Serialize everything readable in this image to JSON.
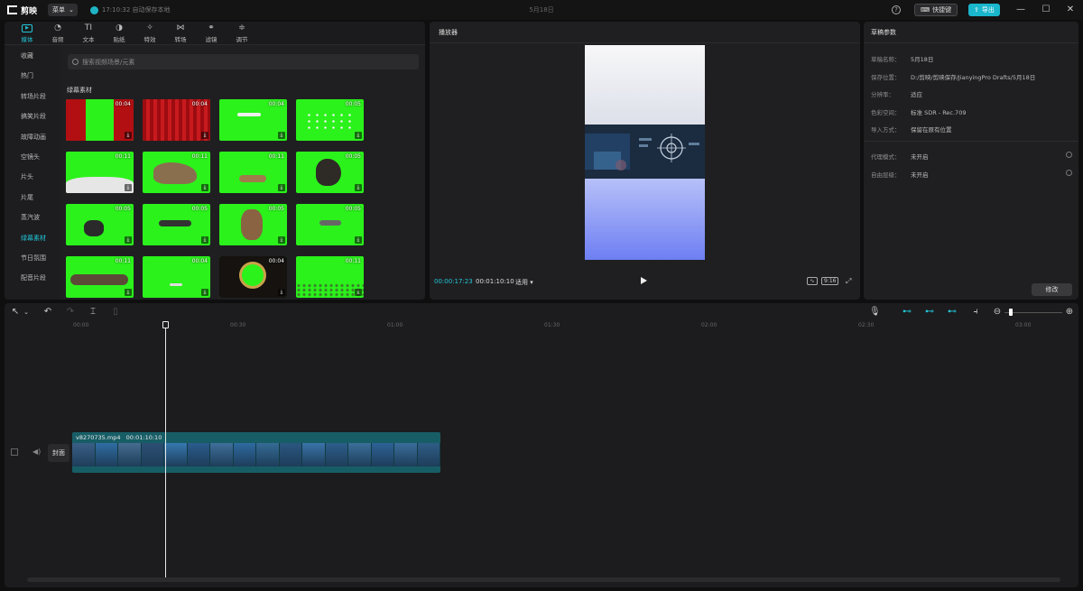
{
  "titlebar": {
    "app_name": "剪映",
    "menu_label": "菜单",
    "save_status": "17:10:32 自动保存本地",
    "doc_title": "5月18日",
    "shortcut_label": "快捷键",
    "export_label": "导出"
  },
  "media_tabs": [
    {
      "label": "媒体",
      "icon": "media-icon",
      "active": true
    },
    {
      "label": "音频",
      "icon": "audio-icon"
    },
    {
      "label": "文本",
      "icon": "text-icon"
    },
    {
      "label": "贴纸",
      "icon": "sticker-icon"
    },
    {
      "label": "特效",
      "icon": "effects-icon"
    },
    {
      "label": "转场",
      "icon": "transition-icon"
    },
    {
      "label": "滤镜",
      "icon": "filter-icon"
    },
    {
      "label": "调节",
      "icon": "adjust-icon"
    }
  ],
  "sidebar": {
    "items": [
      "收藏",
      "热门",
      "转场片段",
      "搞笑片段",
      "故障动画",
      "空镜头",
      "片头",
      "片尾",
      "蒸汽波",
      "绿幕素材",
      "节日氛围",
      "配音片段"
    ],
    "active_index": 9
  },
  "search": {
    "placeholder": "搜索视频场景/元素"
  },
  "section_title": "绿幕素材",
  "thumbs": [
    {
      "dur": "00:04",
      "kind": "curtain"
    },
    {
      "dur": "00:04",
      "kind": "curtain2"
    },
    {
      "dur": "00:04",
      "kind": "plane"
    },
    {
      "dur": "00:05",
      "kind": "birds"
    },
    {
      "dur": "00:11",
      "kind": "smoke"
    },
    {
      "dur": "00:11",
      "kind": "dino"
    },
    {
      "dur": "00:11",
      "kind": "dog"
    },
    {
      "dur": "00:05",
      "kind": "meteor"
    },
    {
      "dur": "00:05",
      "kind": "rock"
    },
    {
      "dur": "00:05",
      "kind": "whale"
    },
    {
      "dur": "00:05",
      "kind": "dino2"
    },
    {
      "dur": "00:05",
      "kind": "shark"
    },
    {
      "dur": "00:11",
      "kind": "log"
    },
    {
      "dur": "00:04",
      "kind": "plane2"
    },
    {
      "dur": "00:04",
      "kind": "badge"
    },
    {
      "dur": "00:11",
      "kind": "grass"
    }
  ],
  "player": {
    "title": "播放器",
    "current_time": "00:00:17:23",
    "total_time": "00:01:10:10",
    "quality": "适用",
    "ratio": "9:16"
  },
  "props": {
    "title": "草稿参数",
    "rows": [
      {
        "k": "草稿名称：",
        "v": "5月18日"
      },
      {
        "k": "保存位置：",
        "v": "D:/剪映/剪映保存/JianyingPro Drafts/5月18日"
      },
      {
        "k": "分辨率：",
        "v": "适应"
      },
      {
        "k": "色彩空间：",
        "v": "标准 SDR - Rec.709"
      },
      {
        "k": "导入方式：",
        "v": "保留在原有位置"
      }
    ],
    "rows2": [
      {
        "k": "代理模式：",
        "v": "未开启"
      },
      {
        "k": "自由层级：",
        "v": "未开启"
      }
    ],
    "modify_label": "修改"
  },
  "timeline": {
    "ticks": [
      "00:00",
      "00:30",
      "01:00",
      "01:30",
      "02:00",
      "02:30",
      "03:00"
    ],
    "clip_name": "v8270735.mp4",
    "clip_duration": "00:01:10:10",
    "cover_label": "封面"
  },
  "colors": {
    "accent": "#22c6d8",
    "green_screen": "#2bf21b",
    "clip": "#175d66"
  }
}
